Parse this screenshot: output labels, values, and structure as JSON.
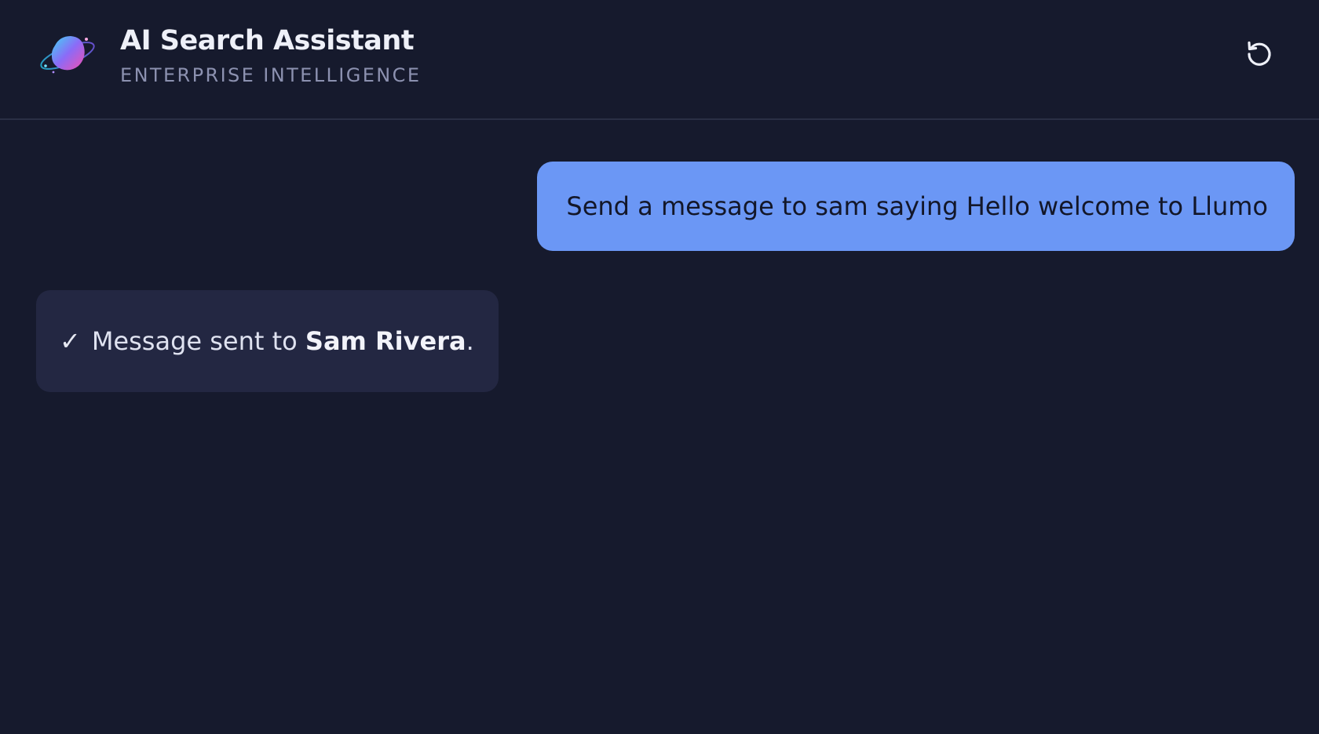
{
  "header": {
    "title": "AI Search Assistant",
    "subtitle": "ENTERPRISE INTELLIGENCE",
    "logo_icon": "planet-logo-icon",
    "reset_icon": "refresh-icon"
  },
  "messages": [
    {
      "role": "user",
      "text": "Send a message to sam saying Hello welcome to Llumo"
    },
    {
      "role": "assistant",
      "check": "✓",
      "prefix": "Message sent to ",
      "recipient": "Sam Rivera",
      "suffix": "."
    }
  ],
  "colors": {
    "background": "#161a2d",
    "user_bubble": "#6b97f5",
    "assistant_bubble": "#232742",
    "divider": "#2a2f45",
    "subtitle": "#8c91b0"
  }
}
